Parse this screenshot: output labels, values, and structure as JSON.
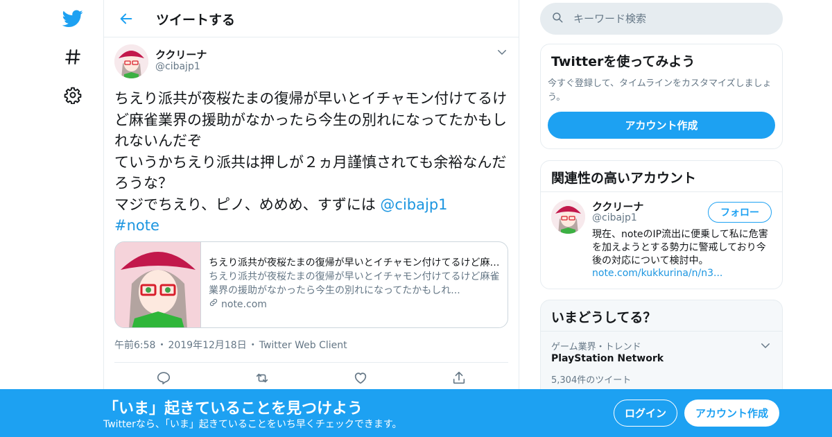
{
  "colors": {
    "accent": "#1da1f2",
    "link": "#1b95e0",
    "muted": "#657786",
    "border": "#e6ecf0"
  },
  "nav": {
    "icons": [
      "twitter-logo-icon",
      "hashtag-icon",
      "gear-icon"
    ]
  },
  "header": {
    "title": "ツイートする"
  },
  "tweet": {
    "author_name": "ククリーナ",
    "author_handle": "@cibajp1",
    "text_plain": "ちえり派共が夜桜たまの復帰が早いとイチャモン付けてるけど麻雀業界の援助がなかったら今生の別れになってたかもしれないんだぞ\nていうかちえり派共は押しが２ヵ月謹慎されても余裕なんだろうな？\nマジでちえり、ピノ、めめめ、すずには ",
    "mention": "@cibajp1",
    "hashtag": "#note",
    "card": {
      "title": "ちえり派共が夜桜たまの復帰が早いとイチャモン付けてるけど麻雀業界の援助がなかったら今生の別れになってたかもしれない",
      "description": "ちえり派共が夜桜たまの復帰が早いとイチャモン付けてるけど麻雀業界の援助がなかったら今生の別れになってたかもしれ...",
      "domain": "note.com"
    },
    "time": "午前6:58",
    "date": "2019年12月18日",
    "client": "Twitter Web Client",
    "sep": "・"
  },
  "search": {
    "placeholder": "キーワード検索"
  },
  "signup_panel": {
    "title": "Twitterを使ってみよう",
    "desc": "今すぐ登録して、タイムラインをカスタマイズしましょう。",
    "button": "アカウント作成"
  },
  "related": {
    "title": "関連性の高いアカウント",
    "name": "ククリーナ",
    "handle": "@cibajp1",
    "follow": "フォロー",
    "bio": "現在、noteのIP流出に便乗して私に危害を加えようとする勢力に警戒しており今後の対応について検討中。",
    "link": "note.com/kukkurina/n/n3..."
  },
  "trends": {
    "title": "いまどうしてる？",
    "category": "ゲーム業界・トレンド",
    "name": "PlayStation Network",
    "count": "5,304件のツイート"
  },
  "bottom_bar": {
    "title": "「いま」起きていることを見つけよう",
    "subtitle": "Twitterなら、「いま」起きていることをいち早くチェックできます。",
    "login": "ログイン",
    "signup": "アカウント作成"
  }
}
